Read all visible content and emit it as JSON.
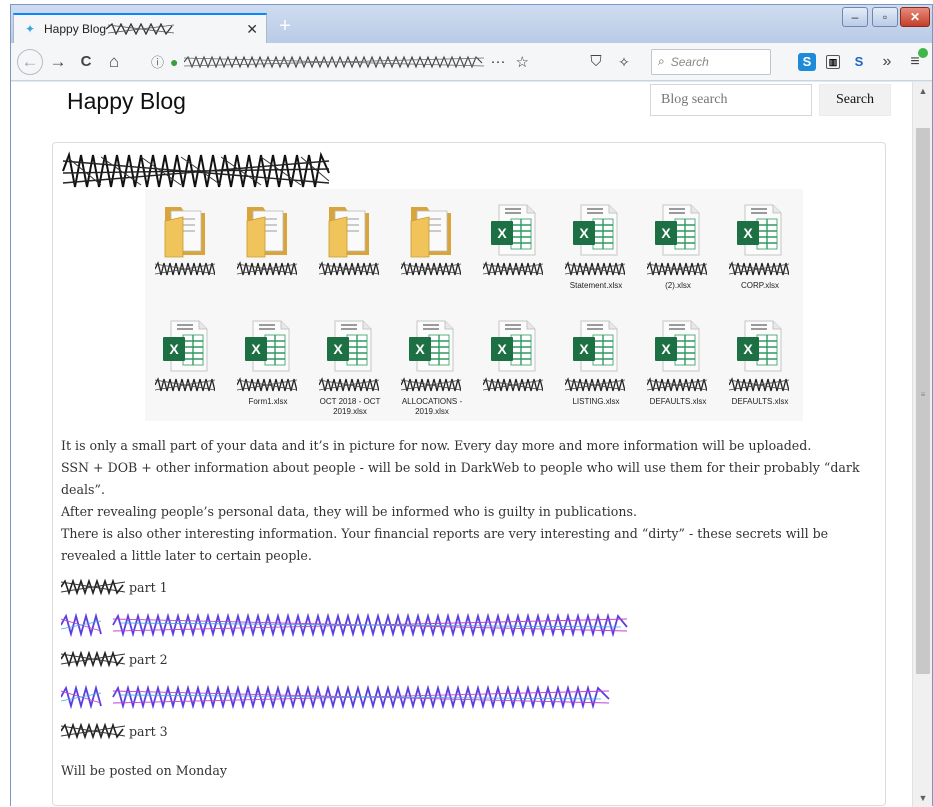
{
  "browser": {
    "tab_title": "Happy Blog",
    "tab_close": "✕",
    "new_tab": "+",
    "window_controls": {
      "minimize": "–",
      "maximize": "▫",
      "close": "✕"
    },
    "nav": {
      "back": "←",
      "forward": "→",
      "reload": "C",
      "home": "⌂"
    },
    "url_actions": {
      "more": "···",
      "bookmark": "☆"
    },
    "search_placeholder": "Search",
    "toolbar": {
      "more": "»",
      "menu": "≡"
    }
  },
  "blog": {
    "title": "Happy Blog",
    "search_placeholder": "Blog search",
    "search_button": "Search"
  },
  "files": [
    {
      "type": "folder",
      "label": ""
    },
    {
      "type": "folder",
      "label": ""
    },
    {
      "type": "folder",
      "label": ""
    },
    {
      "type": "folder",
      "label": ""
    },
    {
      "type": "excel",
      "label": ""
    },
    {
      "type": "excel",
      "label": "Statement.xlsx"
    },
    {
      "type": "excel",
      "label": "(2).xlsx"
    },
    {
      "type": "excel",
      "label": "CORP.xlsx"
    },
    {
      "type": "excel",
      "label": ""
    },
    {
      "type": "excel",
      "label": "Form1.xlsx"
    },
    {
      "type": "excel",
      "label": "OCT 2018 - OCT 2019.xlsx"
    },
    {
      "type": "excel",
      "label": "ALLOCATIONS - 2019.xlsx"
    },
    {
      "type": "excel",
      "label": ""
    },
    {
      "type": "excel",
      "label": "LISTING.xlsx"
    },
    {
      "type": "excel",
      "label": "DEFAULTS.xlsx"
    },
    {
      "type": "excel",
      "label": "DEFAULTS.xlsx"
    }
  ],
  "post": {
    "paragraphs": [
      "It is only a small part of your data and it’s in picture for now. Every day more and more information will be uploaded.",
      "SSN + DOB + other information about people - will be sold in DarkWeb to people who will use them for their probably “dark deals”.",
      "After revealing people’s personal data, they will be informed who is guilty in publications.",
      "There is also other interesting information. Your financial reports are very interesting and “dirty” - these secrets will be revealed a little later to certain people."
    ],
    "parts": [
      "part 1",
      "part 2",
      "part 3"
    ],
    "footer": "Will be posted on Monday"
  },
  "colors": {
    "excel_green": "#1d7044",
    "folder_yellow": "#f0c45a",
    "link_purple": "#6a3fd8"
  }
}
